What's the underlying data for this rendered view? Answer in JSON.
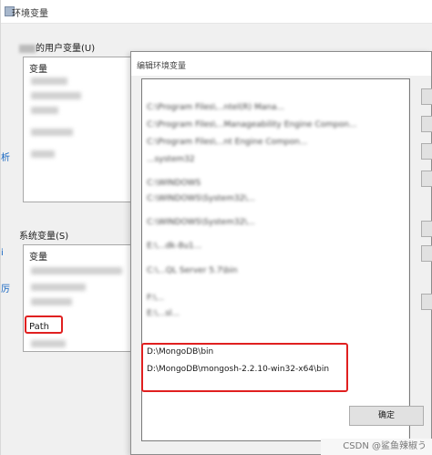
{
  "env_window": {
    "title": "环境变量",
    "user_vars_label_suffix": "的用户变量(U)",
    "user_vars_header": "变量",
    "system_vars_label": "系统变量(S)",
    "system_vars_header": "变量",
    "system_path_item": "Path"
  },
  "edit_dialog": {
    "title": "编辑环境变量",
    "rows": [
      "C:\\Program Files\\...ntel(R) Mana...",
      "C:\\Program Files\\...Manageability Engine Compon...",
      "C:\\Program Files\\...nt Engine Compon...",
      "...system32",
      "C:\\WINDOWS",
      "C:\\WINDOWS\\System32\\...",
      "C:\\WINDOWS\\System32\\...",
      "E:\\...dk-8u1...",
      "C:\\...QL Server 5.7\\bin",
      "F:\\...",
      "E:\\...sl...",
      "D:\\MongoDB\\bin",
      "D:\\MongoDB\\mongosh-2.2.10-win32-x64\\bin"
    ],
    "ok_label": "确定"
  },
  "watermark": "CSDN @鲨鱼辣椒う"
}
